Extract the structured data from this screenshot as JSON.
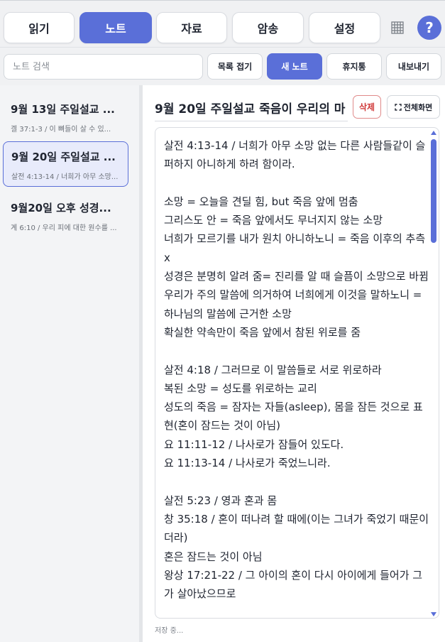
{
  "tabs": [
    {
      "label": "읽기",
      "active": false
    },
    {
      "label": "노트",
      "active": true
    },
    {
      "label": "자료",
      "active": false
    },
    {
      "label": "암송",
      "active": false
    },
    {
      "label": "설정",
      "active": false
    }
  ],
  "header": {
    "grid_icon": "grid-icon",
    "help_label": "?"
  },
  "toolbar": {
    "search_placeholder": "노트 검색",
    "search_value": "",
    "collapse_label": "목록 접기",
    "new_label": "새 노트",
    "trash_label": "휴지통",
    "export_label": "내보내기"
  },
  "notes": [
    {
      "title": "9월 13일 주일설교 ...",
      "preview": "겔 37:1-3 / 이 뼈들이 살 수 있...",
      "active": false
    },
    {
      "title": "9월 20일 주일설교 ...",
      "preview": "살전 4:13-14 / 너희가 아무 소망...",
      "active": true
    },
    {
      "title": "9월20일 오후 성경...",
      "preview": "계 6:10 / 우리 피에 대한 원수를 ...",
      "active": false
    }
  ],
  "editor": {
    "title": "9월 20일 주일설교 죽음이 우리의 마",
    "delete_label": "삭제",
    "fullscreen_label": "전체화면",
    "fullscreen_icon": "expand-icon",
    "content": "살전 4:13-14 / 너희가 아무 소망 없는 다른 사람들같이 슬퍼하지 아니하게 하려 함이라.\n\n소망 = 오늘을 견딜 힘, but 죽음 앞에 멈춤\n그리스도 안 = 죽음 앞에서도 무너지지 않는 소망\n너희가 모르기를 내가 원치 아니하노니 = 죽음 이후의 추측 x\n성경은 분명히 알려 줌= 진리를 알 때 슬픔이 소망으로 바뀜\n우리가 주의 말씀에 의거하여 너희에게 이것을 말하노니 = 하나님의 말씀에 근거한 소망\n확실한 약속만이 죽음 앞에서 참된 위로를 줌\n\n살전 4:18 / 그러므로 이 말씀들로 서로 위로하라\n복된 소망 = 성도를 위로하는 교리\n성도의 죽음 = 잠자는 자들(asleep), 몸을 잠든 것으로 표현(혼이 잠드는 것이 아님)\n요 11:11-12 / 나사로가 잠들어 있도다.\n요 11:13-14 / 나사로가 죽었느니라.\n\n살전 5:23 / 영과 혼과 몸\n창 35:18 / 혼이 떠나려 할 때에(이는 그녀가 죽었기 때문이더라)\n혼은 잠드는 것이 아님\n왕상 17:21-22 / 그 아이의 혼이 다시 아이에게 들어가 그가 살아났으므로"
  },
  "status": "저장 중...",
  "colors": {
    "accent": "#5a6fd8",
    "danger": "#d03a3a"
  }
}
